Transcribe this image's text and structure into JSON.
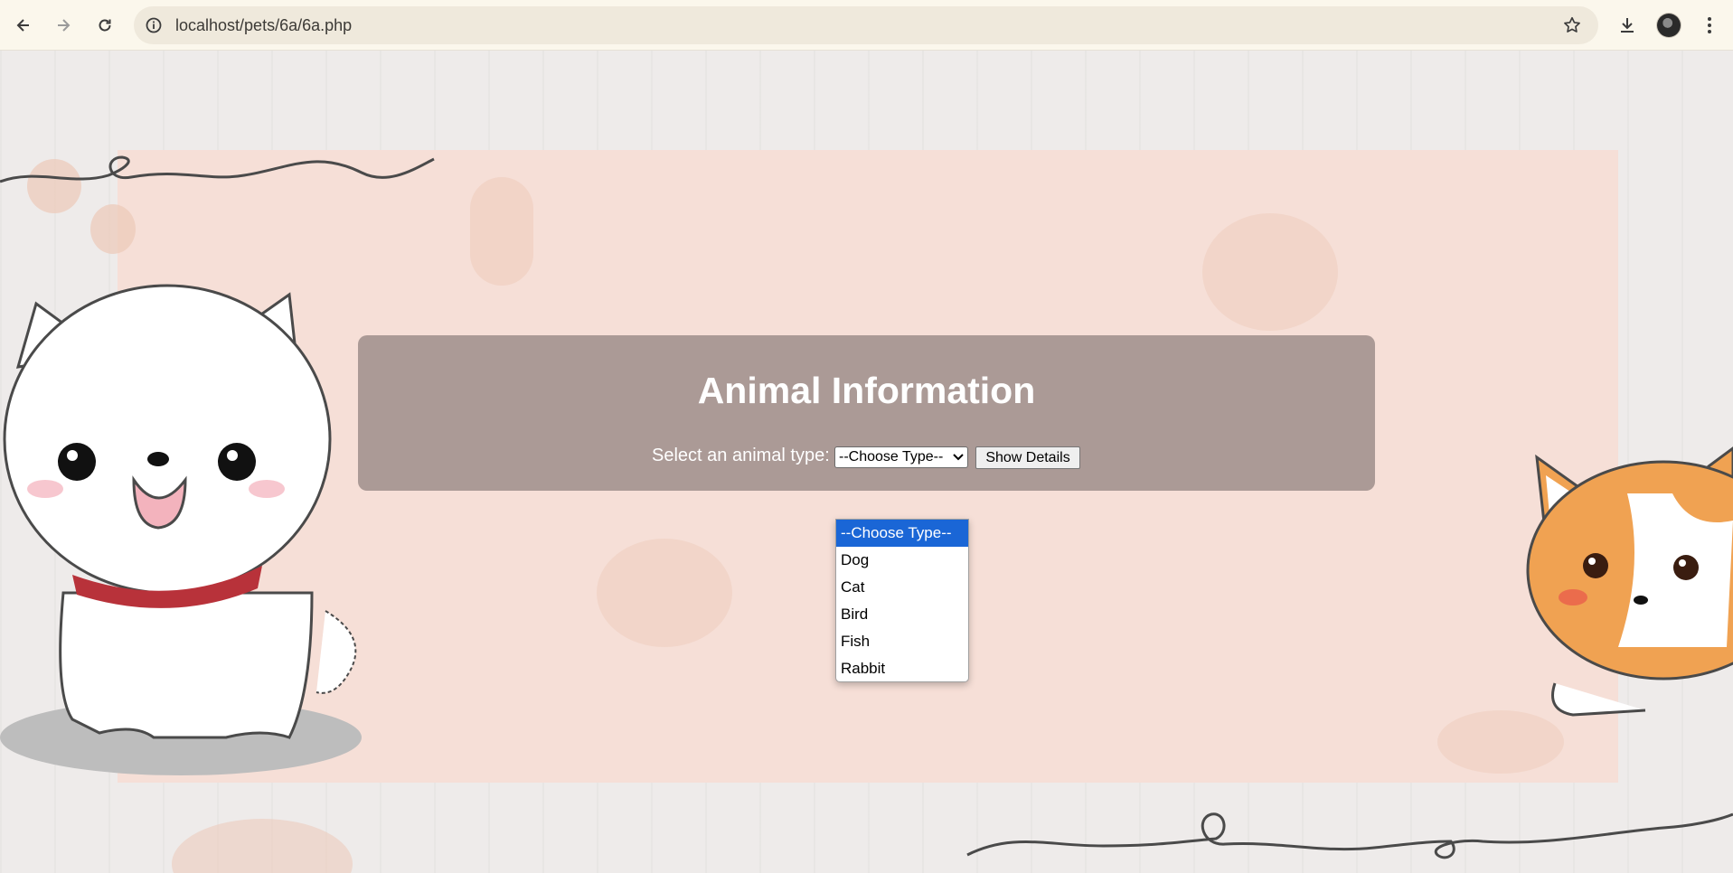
{
  "browser": {
    "url": "localhost/pets/6a/6a.php"
  },
  "page": {
    "title": "Animal Information",
    "select_label": "Select an animal type:",
    "select_value": "--Choose Type--",
    "show_button": "Show Details"
  },
  "dropdown": {
    "options": [
      "--Choose Type--",
      "Dog",
      "Cat",
      "Bird",
      "Fish",
      "Rabbit"
    ],
    "selected_index": 0
  }
}
